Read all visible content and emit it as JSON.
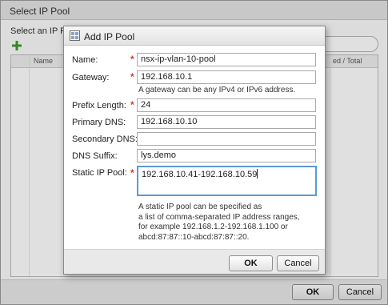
{
  "outer": {
    "title": "Select IP Pool",
    "subtitle": "Select an IP Pool",
    "column_name": "Name",
    "column_used": "ed / Total",
    "ok_label": "OK",
    "cancel_label": "Cancel"
  },
  "dialog": {
    "title": "Add IP Pool",
    "fields": {
      "name": {
        "label": "Name:",
        "value": "nsx-ip-vlan-10-pool",
        "required": "*"
      },
      "gateway": {
        "label": "Gateway:",
        "value": "192.168.10.1",
        "required": "*",
        "hint": "A gateway can be any IPv4 or IPv6 address."
      },
      "prefix_length": {
        "label": "Prefix Length:",
        "value": "24",
        "required": "*"
      },
      "primary_dns": {
        "label": "Primary DNS:",
        "value": "192.168.10.10"
      },
      "secondary_dns": {
        "label": "Secondary DNS:",
        "value": ""
      },
      "dns_suffix": {
        "label": "DNS Suffix:",
        "value": "lys.demo"
      },
      "static_ip_pool": {
        "label": "Static IP Pool:",
        "value": "192.168.10.41-192.168.10.59",
        "required": "*"
      }
    },
    "help_lines": [
      "A static IP pool can be specified as",
      "a list of comma-separated IP address ranges,",
      "for example 192.168.1.2-192.168.1.100 or",
      "abcd:87:87::10-abcd:87:87::20."
    ],
    "ok_label": "OK",
    "cancel_label": "Cancel"
  },
  "colors": {
    "required_star": "#d03a2a",
    "focus_border": "#5b9ad5",
    "add_icon": "#3a9a2a"
  },
  "icons": {
    "add": "plus-icon",
    "dialog": "ip-pool-icon"
  }
}
